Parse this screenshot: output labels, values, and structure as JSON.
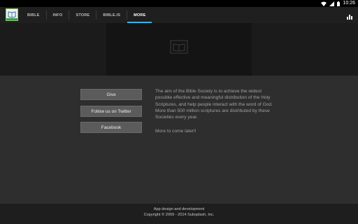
{
  "status_bar": {
    "time": "10:26",
    "icons": [
      "wifi-icon",
      "signal-icon",
      "battery-icon"
    ]
  },
  "app_bar": {
    "logo_icon": "book-logo-icon",
    "tabs": [
      {
        "label": "BIBLE",
        "active": false
      },
      {
        "label": "INFO",
        "active": false
      },
      {
        "label": "STORE",
        "active": false
      },
      {
        "label": "BIBLE.IS",
        "active": false
      },
      {
        "label": "MORE",
        "active": true
      }
    ],
    "stats_icon": "bar-chart-icon",
    "accent_color": "#33b5e5"
  },
  "banner": {
    "image_icon": "bible-society-logo-icon"
  },
  "main": {
    "buttons": {
      "give": "Give",
      "twitter": "Follow us on Twitter",
      "facebook": "Facebook"
    },
    "about_text": "The aim of the Bible Society is to achieve the widest possible effective and meaningful distribution of the Holy Scriptures, and help people interact with the word of God. More than 500 million scriptures are distributed by these Societies every year.",
    "more_later": "More to come later!!"
  },
  "footer": {
    "line1": "App design and development",
    "line2": "Copyright © 2009 - 2014 Subsplash, Inc."
  }
}
